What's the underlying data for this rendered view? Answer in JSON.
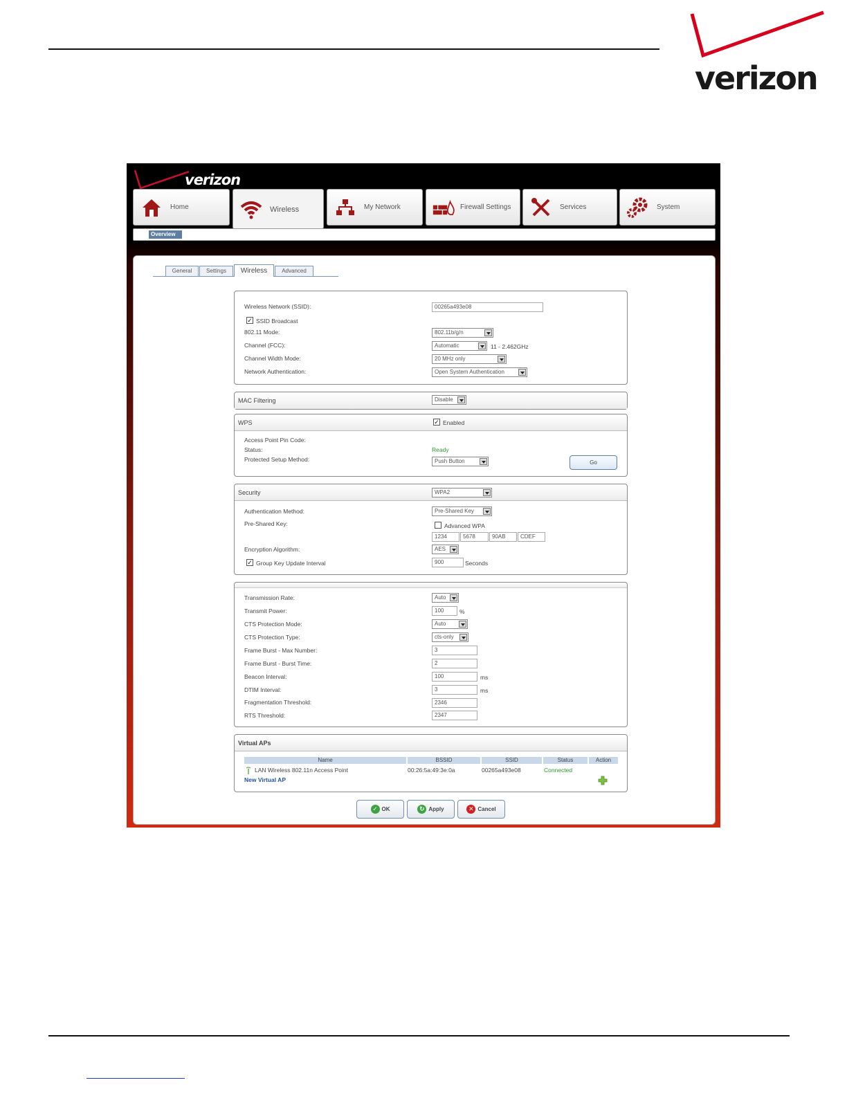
{
  "doc": {
    "logo_text": "verizon"
  },
  "app": {
    "logo_text": "verizon",
    "nav": [
      {
        "label": "Home",
        "icon": "home-icon"
      },
      {
        "label": "Wireless",
        "icon": "wifi-icon"
      },
      {
        "label": "My Network",
        "icon": "network-icon"
      },
      {
        "label": "Firewall Settings",
        "icon": "firewall-icon"
      },
      {
        "label": "Services",
        "icon": "tools-icon"
      },
      {
        "label": "System",
        "icon": "gears-icon"
      }
    ],
    "active_nav": "Wireless",
    "subnav": "Overview",
    "tabs": [
      "General",
      "Settings",
      "Wireless",
      "Advanced"
    ],
    "active_tab": "Wireless"
  },
  "basic": {
    "ssid_label": "Wireless Network (SSID):",
    "ssid_value": "00265a493e08",
    "ssid_broadcast_label": "SSID Broadcast",
    "ssid_broadcast_checked": true,
    "mode_label": "802.11 Mode:",
    "mode_value": "802.11b/g/n",
    "channel_label": "Channel (FCC):",
    "channel_value": "Automatic",
    "channel_note": "11 - 2.462GHz",
    "width_label": "Channel Width Mode:",
    "width_value": "20 MHz only",
    "auth_label": "Network Authentication:",
    "auth_value": "Open System Authentication"
  },
  "mac": {
    "title": "MAC Filtering",
    "value": "Disable"
  },
  "wps": {
    "title": "WPS",
    "enabled_label": "Enabled",
    "enabled_checked": true,
    "pin_label": "Access Point Pin Code:",
    "status_label": "Status:",
    "status_value": "Ready",
    "method_label": "Protected Setup Method:",
    "method_value": "Push Button",
    "go_label": "Go"
  },
  "security": {
    "title": "Security",
    "value": "WPA2",
    "auth_method_label": "Authentication Method:",
    "auth_method_value": "Pre-Shared Key",
    "psk_label": "Pre-Shared Key:",
    "advanced_wpa_label": "Advanced WPA",
    "advanced_wpa_checked": false,
    "key_parts": [
      "1234",
      "5678",
      "90AB",
      "CDEF"
    ],
    "enc_label": "Encryption Algorithm:",
    "enc_value": "AES",
    "group_label": "Group Key Update Interval",
    "group_checked": true,
    "group_value": "900",
    "group_unit": "Seconds"
  },
  "advanced": {
    "tx_rate_label": "Transmission Rate:",
    "tx_rate_value": "Auto",
    "tx_power_label": "Transmit Power:",
    "tx_power_value": "100",
    "tx_power_unit": "%",
    "cts_mode_label": "CTS Protection Mode:",
    "cts_mode_value": "Auto",
    "cts_type_label": "CTS Protection Type:",
    "cts_type_value": "cts-only",
    "burst_max_label": "Frame Burst - Max Number:",
    "burst_max_value": "3",
    "burst_time_label": "Frame Burst - Burst Time:",
    "burst_time_value": "2",
    "beacon_label": "Beacon Interval:",
    "beacon_value": "100",
    "beacon_unit": "ms",
    "dtim_label": "DTIM Interval:",
    "dtim_value": "3",
    "dtim_unit": "ms",
    "frag_label": "Fragmentation Threshold:",
    "frag_value": "2346",
    "rts_label": "RTS Threshold:",
    "rts_value": "2347"
  },
  "vaps": {
    "title": "Virtual APs",
    "columns": [
      "Name",
      "BSSID",
      "SSID",
      "Status",
      "Action"
    ],
    "rows": [
      {
        "name": "LAN Wireless 802.11n Access Point",
        "bssid": "00:26:5a:49:3e:0a",
        "ssid": "00265a493e08",
        "status": "Connected"
      }
    ],
    "new_label": "New Virtual AP"
  },
  "buttons": {
    "ok": "OK",
    "apply": "Apply",
    "cancel": "Cancel"
  }
}
